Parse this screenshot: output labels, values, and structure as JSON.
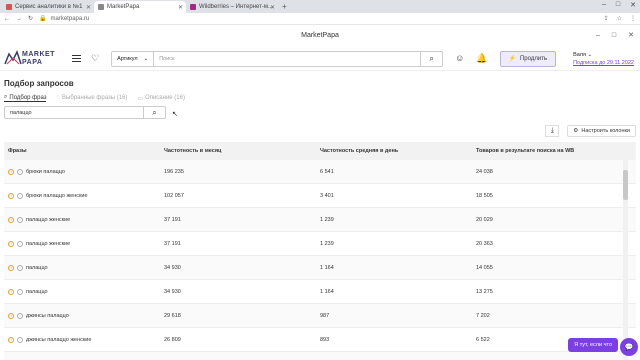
{
  "browser": {
    "tabs": [
      {
        "title": "Сервис аналитики в №1",
        "color": "#d9534f",
        "active": false
      },
      {
        "title": "MarketPapa",
        "color": "#888888",
        "active": true
      },
      {
        "title": "Wildberries – Интернет-м...",
        "color": "#a12a83",
        "active": false
      }
    ],
    "url": "marketpapa.ru"
  },
  "app": {
    "title": "MarketPapa",
    "logo_line1": "MARKET",
    "logo_line2": "PAPA",
    "search": {
      "select_label": "Артикул",
      "placeholder": "Поиск"
    },
    "extend_label": "Продлить",
    "user_name": "Валя",
    "subscription": "Подписка до 29.11.2022"
  },
  "page": {
    "title": "Подбор запросов",
    "tabs": [
      {
        "label": "Подбор фраз",
        "active": true
      },
      {
        "label": "Выбранные фразы (16)",
        "active": false
      },
      {
        "label": "Описание (16)",
        "active": false
      }
    ],
    "query_value": "палаццо",
    "columns_button": "Настроить колонки",
    "accent": "#7b3fe4"
  },
  "table": {
    "headers": [
      "Фразы",
      "Частотность в месяц",
      "Частотность средняя в день",
      "Товаров в результате поиска на WB"
    ],
    "rows": [
      [
        "брюки палаццо",
        "196 235",
        "6 541",
        "24 038"
      ],
      [
        "брюки палаццо женские",
        "102 057",
        "3 401",
        "18 505"
      ],
      [
        "палаццо женские",
        "37 191",
        "1 239",
        "20 029"
      ],
      [
        "палаццо женские",
        "37 191",
        "1 239",
        "20 363"
      ],
      [
        "палаццо",
        "34 930",
        "1 164",
        "14 055"
      ],
      [
        "палаццо",
        "34 930",
        "1 164",
        "13 275"
      ],
      [
        "джинсы палаццо",
        "29 618",
        "987",
        "7 202"
      ],
      [
        "джинсы палаццо женские",
        "26 809",
        "893",
        "6 522"
      ],
      [
        "брюки женские палаццо",
        "21 639",
        "721",
        "18 505"
      ]
    ]
  },
  "chat_label": "Я тут, если что"
}
